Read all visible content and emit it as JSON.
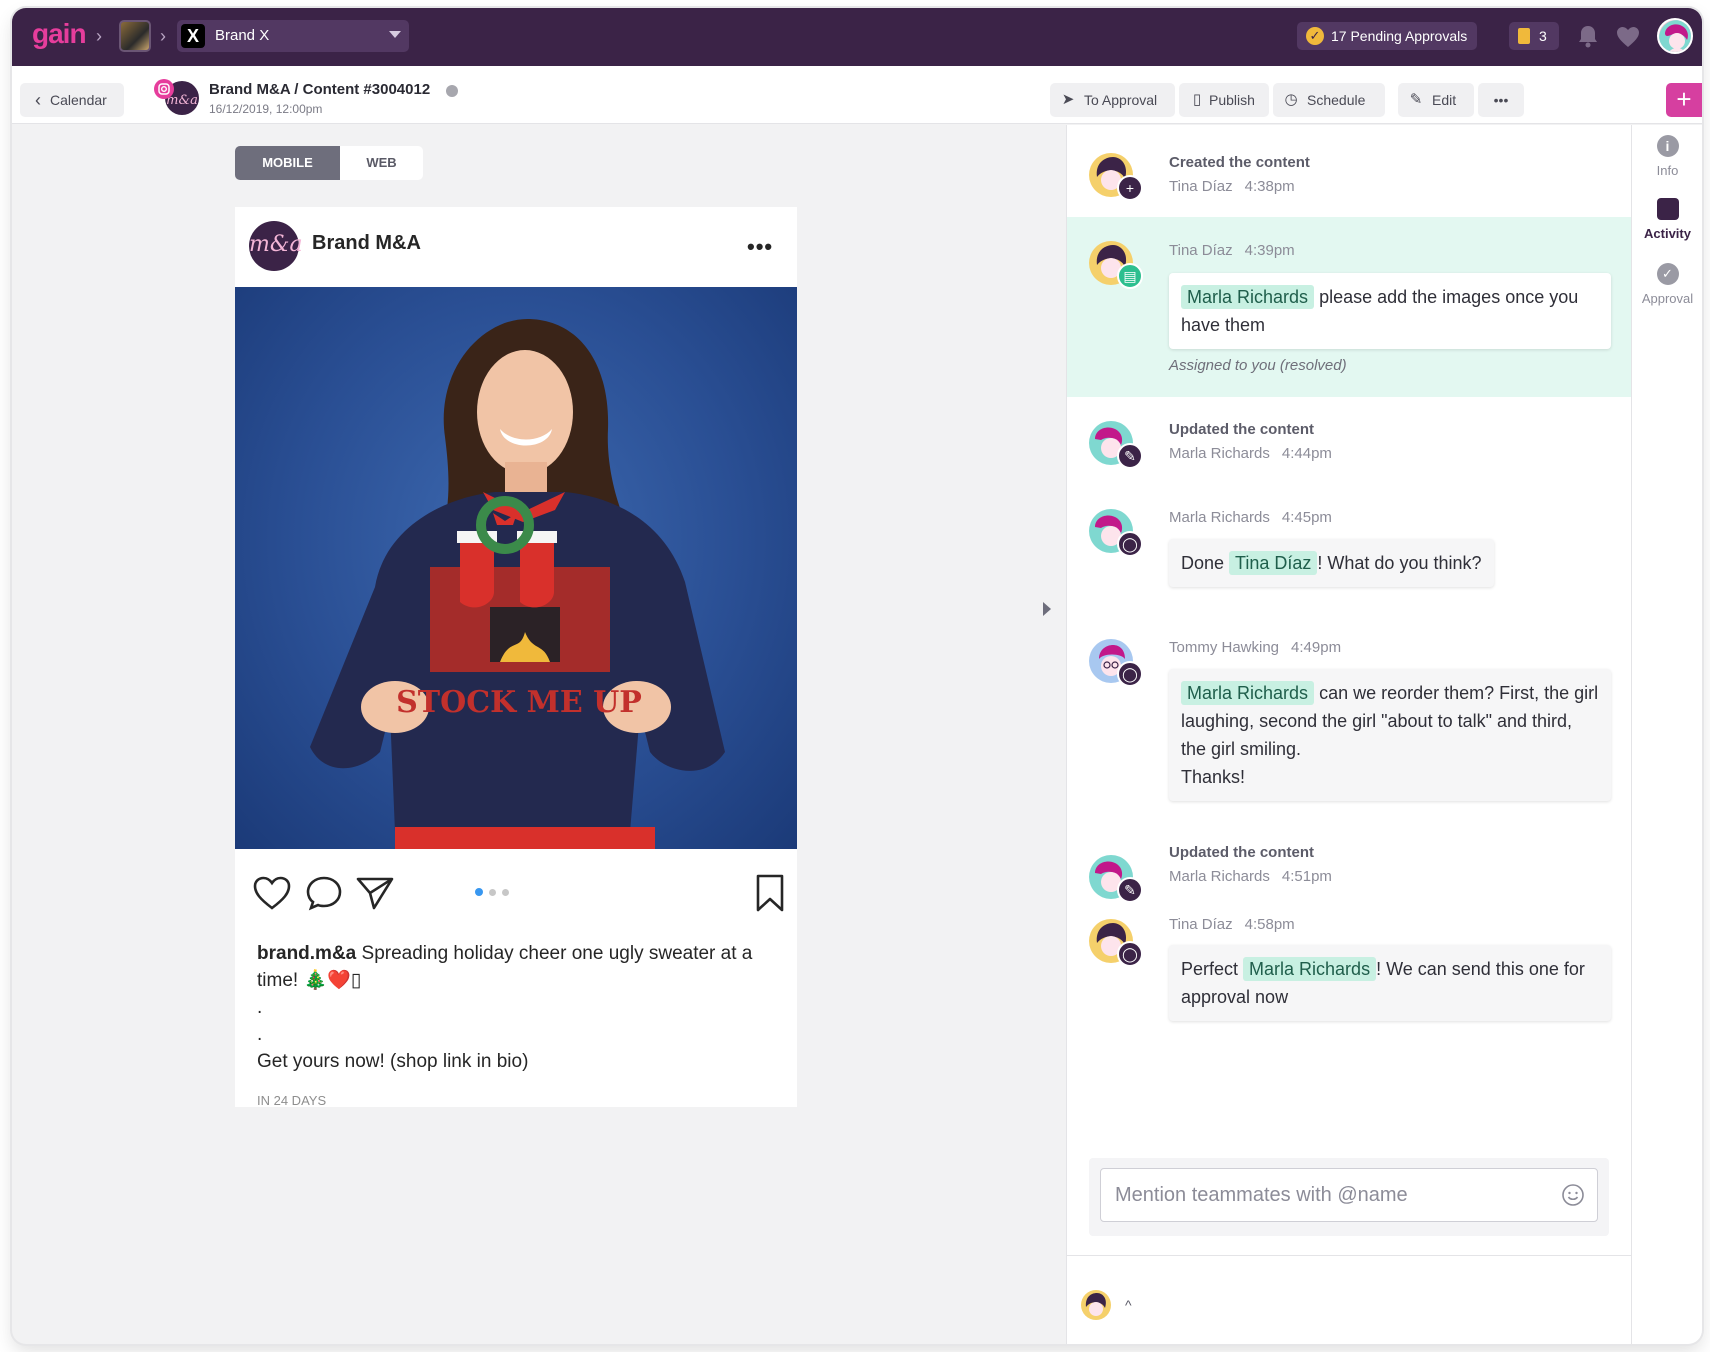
{
  "topbar": {
    "logo": "gain",
    "brand": "Brand X",
    "pending_approvals": "17 Pending Approvals",
    "tasks_count": "3",
    "colors": {
      "bar": "#3b2347",
      "accent": "#e63d9c",
      "badge": "#f0b93b"
    }
  },
  "subbar": {
    "back_label": "Calendar",
    "title": "Brand M&A / Content #3004012",
    "date": "16/12/2019, 12:00pm",
    "actions": {
      "to_approval": "To Approval",
      "publish": "Publish",
      "schedule": "Schedule",
      "edit": "Edit",
      "more": "•••",
      "add": "+"
    }
  },
  "preview": {
    "tabs": [
      "MOBILE",
      "WEB"
    ],
    "active_tab": "MOBILE",
    "account_name": "Brand M&A",
    "account_monogram": "m&a",
    "more": "•••",
    "caption": {
      "handle": "brand.m&a",
      "text": "Spreading holiday cheer one ugly sweater at a time! 🎄❤️▯",
      "dots": [
        ".",
        "."
      ],
      "cta": "Get yours now! (shop link in bio)"
    },
    "timing": "IN 24 DAYS",
    "sweater_text": "STOCK ME UP",
    "carousel_pages": 3,
    "carousel_active": 1
  },
  "activity": [
    {
      "kind": "event",
      "title": "Created the content",
      "user": "Tina Díaz",
      "time": "4:38pm",
      "icon": "plus-icon"
    },
    {
      "kind": "comment",
      "user": "Tina Díaz",
      "time": "4:39pm",
      "mention": "Marla Richards",
      "text": "please add the images once you have them",
      "note": "Assigned to you (resolved)",
      "icon": "task-icon",
      "highlighted": true
    },
    {
      "kind": "event",
      "title": "Updated the content",
      "user": "Marla Richards",
      "time": "4:44pm",
      "icon": "pencil-icon"
    },
    {
      "kind": "comment",
      "user": "Marla Richards",
      "time": "4:45pm",
      "before": "Done ",
      "mention": "Tina Díaz",
      "text": "! What do you think?",
      "icon": "comment-icon"
    },
    {
      "kind": "comment",
      "user": "Tommy Hawking",
      "time": "4:49pm",
      "mention": "Marla Richards",
      "text": "can we reorder them? First, the girl laughing, second the girl \"about to talk\" and third, the girl smiling.",
      "text2": "Thanks!",
      "icon": "comment-icon"
    },
    {
      "kind": "event",
      "title": "Updated the content",
      "user": "Marla Richards",
      "time": "4:51pm",
      "icon": "pencil-icon"
    },
    {
      "kind": "comment",
      "user": "Tina Díaz",
      "time": "4:58pm",
      "before": "Perfect ",
      "mention": "Marla Richards",
      "text": "! We can send this one for approval now",
      "icon": "comment-icon"
    }
  ],
  "composer": {
    "placeholder": "Mention teammates with @name"
  },
  "rail": [
    {
      "label": "Info",
      "icon": "info-icon",
      "active": false
    },
    {
      "label": "Activity",
      "icon": "activity-icon",
      "active": true
    },
    {
      "label": "Approval",
      "icon": "approval-icon",
      "active": false
    }
  ]
}
